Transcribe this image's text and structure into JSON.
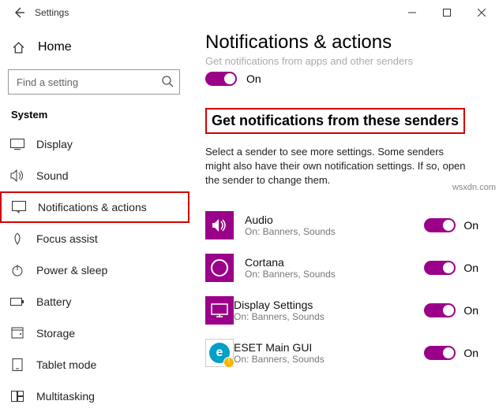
{
  "window": {
    "title": "Settings"
  },
  "sidebar": {
    "home_label": "Home",
    "search_placeholder": "Find a setting",
    "group_label": "System",
    "items": [
      {
        "label": "Display"
      },
      {
        "label": "Sound"
      },
      {
        "label": "Notifications & actions"
      },
      {
        "label": "Focus assist"
      },
      {
        "label": "Power & sleep"
      },
      {
        "label": "Battery"
      },
      {
        "label": "Storage"
      },
      {
        "label": "Tablet mode"
      },
      {
        "label": "Multitasking"
      }
    ]
  },
  "content": {
    "page_title": "Notifications & actions",
    "faded_subtitle": "Get notifications from apps and other senders",
    "master_toggle_state": "On",
    "section_header": "Get notifications from these senders",
    "description": "Select a sender to see more settings. Some senders might also have their own notification settings. If so, open the sender to change them.",
    "senders": [
      {
        "name": "Audio",
        "sub": "On: Banners, Sounds",
        "state": "On"
      },
      {
        "name": "Cortana",
        "sub": "On: Banners, Sounds",
        "state": "On"
      },
      {
        "name": "Display Settings",
        "sub": "On: Banners, Sounds",
        "state": "On"
      },
      {
        "name": "ESET Main GUI",
        "sub": "On: Banners, Sounds",
        "state": "On"
      }
    ]
  },
  "watermark": "wsxdn.com"
}
